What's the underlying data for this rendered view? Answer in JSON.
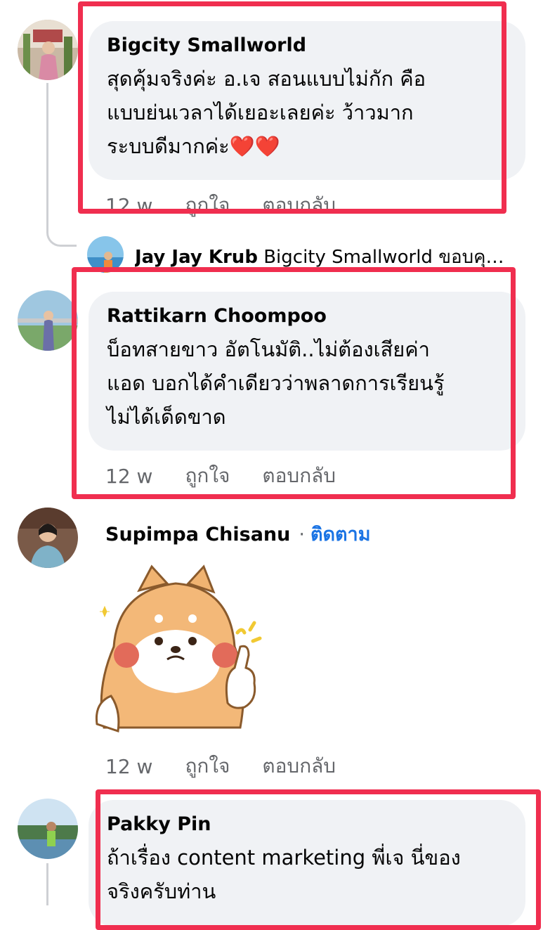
{
  "comments": [
    {
      "author": "Bigcity Smallworld",
      "text": "สุดคุ้มจริงค่ะ อ.เจ  สอนแบบไม่กัก คือ\nแบบย่นเวลาได้เยอะเลยค่ะ  ว้าวมาก\nระบบดีมากค่ะ",
      "emoji": "❤️❤️",
      "time": "12 w",
      "like": "ถูกใจ",
      "reply": "ตอบกลับ"
    },
    {
      "author": "Rattikarn Choompoo",
      "text": "บ็อทสายขาว อัตโนมัติ..ไม่ต้องเสียค่า\nแอด  บอกได้คำเดียวว่าพลาดการเรียนรู้\nไม่ได้เด็ดขาด",
      "time": "12 w",
      "like": "ถูกใจ",
      "reply": "ตอบกลับ"
    },
    {
      "author": "Supimpa Chisanu",
      "follow": "ติดตาม",
      "sticker": "shiba-thumbs-up-sticker",
      "time": "12 w",
      "like": "ถูกใจ",
      "reply": "ตอบกลับ"
    },
    {
      "author": "Pakky Pin",
      "text": "ถ้าเรื่อง content marketing พี่เจ นี่ของ\nจริงครับท่าน"
    }
  ],
  "reply_preview": {
    "author": "Jay Jay Krub",
    "text": "Bigcity Smallworld ขอบคุ…"
  },
  "colors": {
    "highlight": "#f02e4f",
    "bubble": "#f0f2f5",
    "follow": "#1b74e4"
  }
}
